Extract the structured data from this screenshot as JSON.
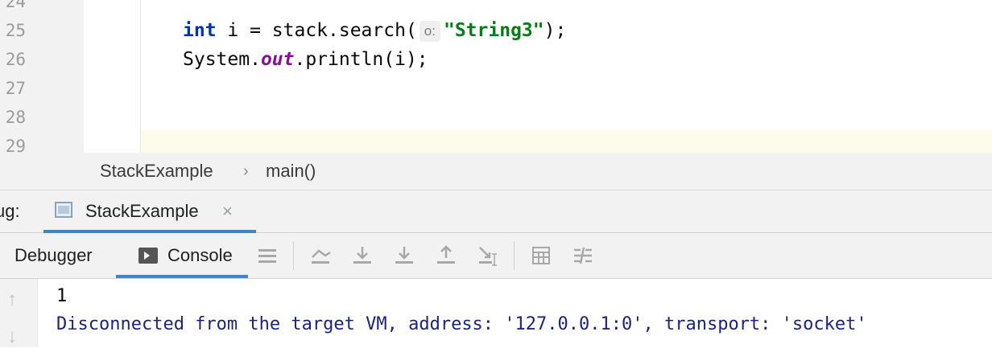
{
  "editor": {
    "line_numbers": [
      "24",
      "25",
      "26",
      "27",
      "28",
      "29"
    ],
    "line25": {
      "kw_int": "int",
      "part1": " i = stack.search(",
      "hint": "o:",
      "string_literal": "\"String3\"",
      "part2": ");"
    },
    "line26": {
      "part1": "System.",
      "field_out": "out",
      "part2": ".println(i);"
    }
  },
  "breadcrumb": {
    "class_name": "StackExample",
    "separator": "›",
    "method_name": "main()"
  },
  "debug_panel": {
    "label": "ug:",
    "session_tab": "StackExample",
    "close_glyph": "×"
  },
  "toolbar": {
    "tabs": [
      "Debugger",
      "Console"
    ],
    "icons": [
      "menu-icon",
      "show-execution-point-icon",
      "step-over-icon",
      "step-into-icon",
      "step-out-icon",
      "run-to-cursor-icon",
      "evaluate-expression-icon",
      "trace-current-stream-icon"
    ]
  },
  "console": {
    "output_lines": [
      "1",
      "Disconnected from the target VM, address: '127.0.0.1:0', transport: 'socket'"
    ]
  },
  "colors": {
    "accent": "#4083c9",
    "keyword": "#0033b3",
    "string": "#067d17",
    "field": "#871094",
    "console_system": "#1a237e"
  }
}
